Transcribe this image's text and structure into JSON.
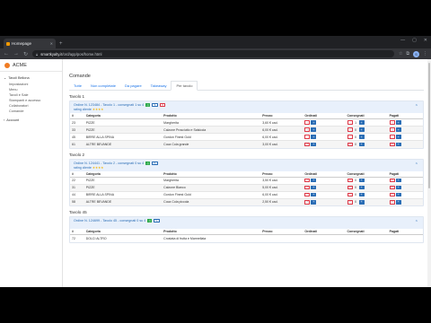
{
  "browser": {
    "tab_title": "Homepage",
    "url_host": "smartkyalty.it",
    "url_path": "/ord/app/pos/home.html",
    "new_tab": "+",
    "window_controls": [
      "—",
      "▢",
      "✕"
    ]
  },
  "app": {
    "brand": "ACME",
    "menu": {
      "group1": "Tavoli Bellona",
      "items": [
        "Impostazioni",
        "Menu",
        "Tavoli e Sale",
        "Stampanti e accesso",
        "Collaboratori",
        "Comande"
      ],
      "group2": "Account"
    },
    "page_title": "Comande",
    "tabs": [
      "Tutte",
      "Non completate",
      "Da pagare",
      "Takeaway",
      "Per tavolo"
    ],
    "active_tab": 4,
    "columns": [
      "#",
      "Categoria",
      "Prodotto",
      "Prezzo",
      "Ordinati",
      "Consegnati",
      "Pagati"
    ],
    "sections": [
      {
        "title": "Tavolo 1",
        "order_line": "Ordine N. 123484 - Tavolo 1 - consegnati 1 su 4",
        "rating": "rating cliente",
        "stars": "★★★★",
        "rows": [
          {
            "n": "23",
            "cat": "PIZZE",
            "prod": "Margherita",
            "price": "3,60 € cad.",
            "ord": "1",
            "cons": "1",
            "pag": "1"
          },
          {
            "n": "33",
            "cat": "PIZZE",
            "prod": "Calzone Prosciutto e Salsiccia",
            "price": "6,00 € cad.",
            "ord": "1",
            "cons": "0",
            "pag": "1"
          },
          {
            "n": "45",
            "cat": "BIRRE ALLA SPINA",
            "prod": "Gordon Finest Gold",
            "price": "6,00 € cad.",
            "ord": "1",
            "cons": "0",
            "pag": "1"
          },
          {
            "n": "61",
            "cat": "ALTRE BEVANDE",
            "prod": "Coca Cola grande",
            "price": "3,00 € cad.",
            "ord": "1",
            "cons": "0",
            "pag": "1"
          }
        ]
      },
      {
        "title": "Tavolo 2",
        "order_line": "Ordine N. 124441 - Tavolo 2 - consegnati 0 su 4",
        "rating": "rating cliente",
        "stars": "★★★★",
        "rows": [
          {
            "n": "22",
            "cat": "PIZZE",
            "prod": "Margherita",
            "price": "3,50 € cad.",
            "ord": "1",
            "cons": "0",
            "pag": "0"
          },
          {
            "n": "31",
            "cat": "PIZZE",
            "prod": "Calzone Bianco",
            "price": "5,00 € cad.",
            "ord": "1",
            "cons": "0",
            "pag": "0"
          },
          {
            "n": "44",
            "cat": "BIRRE ALLA SPINA",
            "prod": "Gordon Finest Gold",
            "price": "6,00 € cad.",
            "ord": "1",
            "cons": "0",
            "pag": "0"
          },
          {
            "n": "58",
            "cat": "ALTRE BEVANDE",
            "prod": "Coca Cola piccola",
            "price": "2,50 € cad.",
            "ord": "1",
            "cons": "0",
            "pag": "0"
          }
        ]
      },
      {
        "title": "Tavolo 45",
        "order_line": "Ordine N. 124699 - Tavolo 45 - consegnati 0 su 4",
        "rows": [
          {
            "n": "72",
            "cat": "DOLCI ALTRO",
            "prod": "Crostata di frutta e Marmellata",
            "price": "",
            "ord": "",
            "cons": "",
            "pag": ""
          }
        ]
      }
    ]
  }
}
